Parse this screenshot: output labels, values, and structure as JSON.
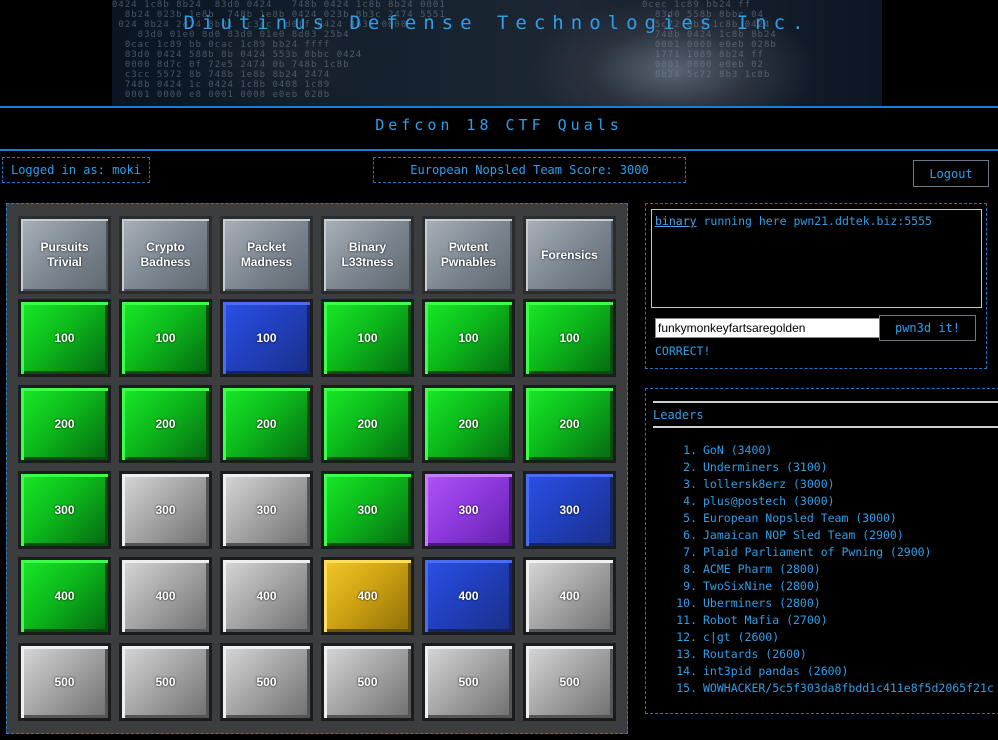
{
  "site": {
    "title": "Diutinus Defense Technologies Inc.",
    "subtitle": "Defcon 18 CTF Quals"
  },
  "status": {
    "logged_in": "Logged in as: moki",
    "team_score": "European Nopsled Team Score: 3000",
    "logout_label": "Logout"
  },
  "board": {
    "categories": [
      "Pursuits\nTrivial",
      "Crypto\nBadness",
      "Packet\nMadness",
      "Binary\nL33tness",
      "Pwtent\nPwnables",
      "Forensics"
    ],
    "rows": [
      {
        "value": "100",
        "states": [
          "green",
          "green",
          "blue",
          "green",
          "green",
          "green"
        ]
      },
      {
        "value": "200",
        "states": [
          "green",
          "green",
          "green",
          "green",
          "green",
          "green"
        ]
      },
      {
        "value": "300",
        "states": [
          "green",
          "grey",
          "grey",
          "green",
          "purple",
          "blue"
        ]
      },
      {
        "value": "400",
        "states": [
          "green",
          "grey",
          "grey",
          "gold",
          "blue",
          "grey"
        ]
      },
      {
        "value": "500",
        "states": [
          "grey",
          "grey",
          "grey",
          "grey",
          "grey",
          "grey"
        ]
      }
    ]
  },
  "question": {
    "link_text": "binary",
    "text": " running here pwn21.ddtek.biz:5555",
    "answer_value": "funkymonkeyfartsaregolden",
    "submit_label": "pwn3d it!",
    "result": "CORRECT!"
  },
  "leaders": {
    "title": "Leaders",
    "entries": [
      {
        "rank": "1.",
        "team": "GoN (3400)"
      },
      {
        "rank": "2.",
        "team": "Underminers (3100)"
      },
      {
        "rank": "3.",
        "team": "lollersk8erz (3000)"
      },
      {
        "rank": "4.",
        "team": "plus@postech (3000)"
      },
      {
        "rank": "5.",
        "team": "European Nopsled Team (3000)"
      },
      {
        "rank": "6.",
        "team": "Jamaican NOP Sled Team (2900)"
      },
      {
        "rank": "7.",
        "team": "Plaid Parliament of Pwning (2900)"
      },
      {
        "rank": "8.",
        "team": "ACME Pharm (2800)"
      },
      {
        "rank": "9.",
        "team": "TwoSixNine (2800)"
      },
      {
        "rank": "10.",
        "team": "Uberminers (2800)"
      },
      {
        "rank": "11.",
        "team": "Robot Mafia (2700)"
      },
      {
        "rank": "12.",
        "team": "c|gt (2600)"
      },
      {
        "rank": "13.",
        "team": "Routards (2600)"
      },
      {
        "rank": "14.",
        "team": "int3pid pandas (2600)"
      },
      {
        "rank": "15.",
        "team": "WOWHACKER/5c5f303da8fbdd1c411e8f5d2065f21c"
      }
    ]
  },
  "colors": {
    "accent": "#2f9ee8",
    "solved": "#0cb91b",
    "open": "#a8a8a8"
  }
}
